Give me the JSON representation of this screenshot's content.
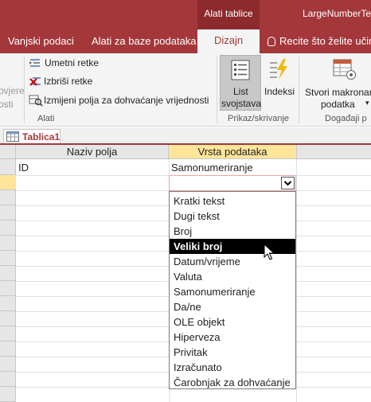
{
  "titlebar": {
    "context_tab": "Alati tablice",
    "app_title": "LargeNumberTe"
  },
  "ribbon_tabs": [
    {
      "label": "Vanjski podaci",
      "active": false
    },
    {
      "label": "Alati za baze podataka",
      "active": false
    },
    {
      "label": "Dizajn",
      "active": true
    }
  ],
  "tell_me": "Recite što želite učini",
  "ribbon": {
    "cut_left_top": "ovjere",
    "cut_left_bottom": "osti",
    "insert_rows": "Umetni retke",
    "delete_rows": "Izbriši retke",
    "modify_lookups": "Izmijeni polja za dohvaćanje vrijednosti",
    "group_tools": "Alati",
    "property_sheet_line1": "List",
    "property_sheet_line2": "svojstava",
    "indexes": "Indeksi",
    "group_show_hide": "Prikaz/skrivanje",
    "macros_line1": "Stvori makronar",
    "macros_line2": "podatka",
    "group_events": "Događaji p"
  },
  "document_tab": "Tablica1",
  "grid": {
    "col_field_name": "Naziv polja",
    "col_data_type": "Vrsta podataka",
    "rows": [
      {
        "field": "ID",
        "type": "Samonumeriranje"
      }
    ]
  },
  "dropdown": {
    "selected_index": 3,
    "options": [
      "Kratki tekst",
      "Dugi tekst",
      "Broj",
      "Veliki broj",
      "Datum/vrijeme",
      "Valuta",
      "Samonumeriranje",
      "Da/ne",
      "OLE objekt",
      "Hiperveza",
      "Privitak",
      "Izračunato",
      "Čarobnjak za dohvaćanje"
    ]
  },
  "colors": {
    "accent": "#a4373a",
    "header_highlight": "#ffe599",
    "selected_option": "#000000"
  }
}
